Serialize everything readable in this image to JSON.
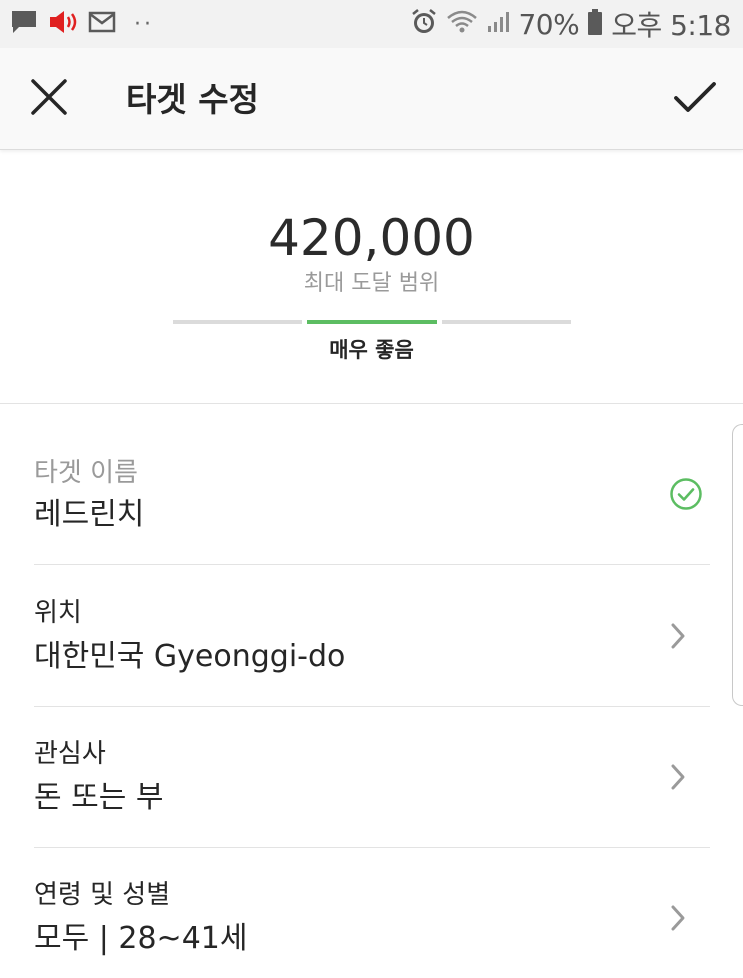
{
  "status_bar": {
    "battery": "70%",
    "time": "오후 5:18",
    "more_dots": "··"
  },
  "header": {
    "title": "타겟 수정"
  },
  "reach": {
    "number": "420,000",
    "label": "최대 도달 범위",
    "rating": "매우 좋음",
    "meter_active_index": 1,
    "meter_segments": 3
  },
  "rows": {
    "target_name": {
      "label": "타겟 이름",
      "value": "레드린치"
    },
    "location": {
      "label": "위치",
      "value": "대한민국 Gyeonggi-do"
    },
    "interests": {
      "label": "관심사",
      "value": "돈 또는 부"
    },
    "age_gender": {
      "label": "연령 및 성별",
      "value": "모두 | 28~41세"
    }
  },
  "colors": {
    "accent_green": "#5cbd62",
    "muted_text": "#9a9a9a",
    "notification_red": "#e02020"
  },
  "icons": {
    "close": "close-icon",
    "confirm": "checkmark-icon",
    "valid": "check-circle-icon",
    "chevron": "chevron-right-icon"
  }
}
